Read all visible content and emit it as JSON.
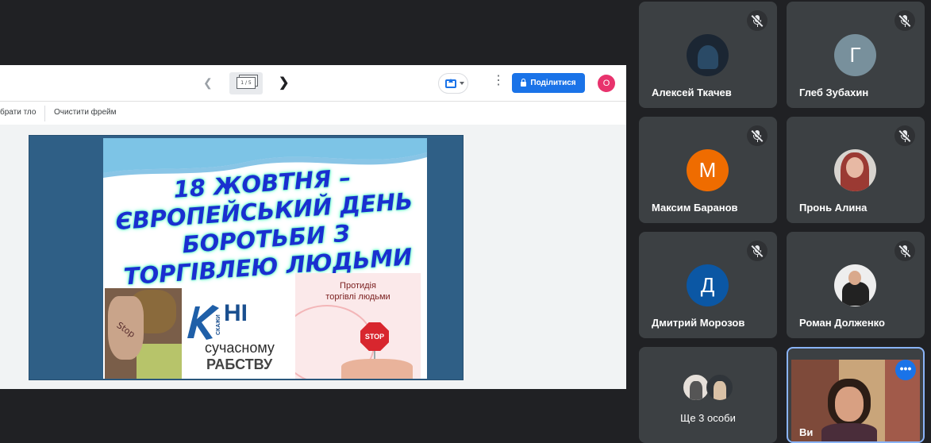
{
  "share": {
    "prev_icon": "chevron-left-icon",
    "slide_counter": "1 / 5",
    "next_icon": "chevron-right-icon",
    "present_icon": "present-screen-icon",
    "more_icon": "more-vert-icon",
    "share_label": "Поділитися",
    "account_initial": "О",
    "toolbar_left_label": "брати тло",
    "clear_frame_label": "Очистити фрейм"
  },
  "slide": {
    "title_lines": [
      "18  ЖОВТНЯ –",
      "ЄВРОПЕЙСЬКИЙ ДЕНЬ",
      "БОРОТЬБИ З",
      "ТОРГІВЛЕЮ ЛЮДЬМИ"
    ],
    "stop_word": "Stop",
    "ni_vertical": "СКАЖИ",
    "ni_big": "НІ",
    "ni_line1": "сучасному",
    "ni_line2": "РАБСТВУ",
    "protydia_line1": "Протидія",
    "protydia_line2": "торгівлі людьми",
    "stop_sign": "STOP"
  },
  "participants": [
    {
      "name": "Алексей Ткачев",
      "avatar_type": "photo",
      "muted": true
    },
    {
      "name": "Глеб Зубахин",
      "avatar_letter": "Г",
      "avatar_color": "#78909c",
      "muted": true
    },
    {
      "name": "Максим Баранов",
      "avatar_letter": "М",
      "avatar_color": "#ef6c00",
      "muted": true
    },
    {
      "name": "Пронь Алина",
      "avatar_type": "photo",
      "muted": true
    },
    {
      "name": "Дмитрий Морозов",
      "avatar_letter": "Д",
      "avatar_color": "#0b57a4",
      "muted": true
    },
    {
      "name": "Роман Долженко",
      "avatar_type": "photo",
      "muted": true
    }
  ],
  "others": {
    "label": "Ще 3 особи"
  },
  "self": {
    "name": "Ви",
    "menu_icon": "more-horiz-icon"
  },
  "colors": {
    "accent": "#1a73e8",
    "background": "#202124",
    "tile": "#3c4043"
  }
}
